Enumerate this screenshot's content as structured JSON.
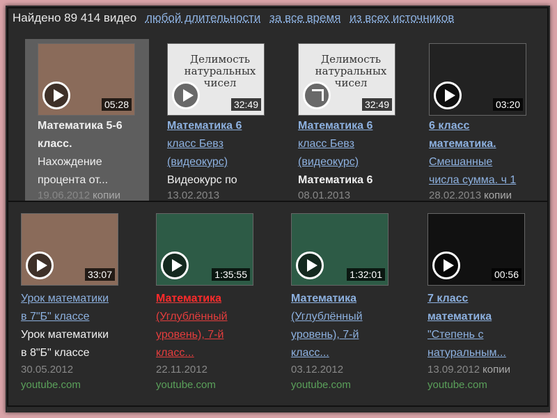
{
  "header": {
    "found": "Найдено 89 414 видео",
    "filter_duration": "любой длительности",
    "filter_time": "за все время",
    "filter_source": "из всех источников"
  },
  "row1": [
    {
      "duration": "05:28",
      "title_lines": [
        "Математика 5-6",
        "класс.",
        "Нахождение",
        "процента от..."
      ],
      "date": "19.06.2012",
      "copies": "копии"
    },
    {
      "duration": "32:49",
      "thumb_text": "Делимость натуральных чисел",
      "title_lines": [
        "Математика 6",
        "класс Бевз",
        "(видеокурс)",
        "Видеокурс по"
      ],
      "date": "13.02.2013"
    },
    {
      "duration": "32:49",
      "thumb_text": "Делимость натуральных чисел",
      "title_lines": [
        "Математика 6",
        "класс Бевз",
        "(видеокурс)",
        "Математика 6"
      ],
      "date": "08.01.2013"
    },
    {
      "duration": "03:20",
      "title_lines": [
        "6 класс",
        "математика.",
        "Смешанные",
        "числа сумма. ч 1"
      ],
      "date": "28.02.2013",
      "copies": "копии"
    }
  ],
  "row2": [
    {
      "duration": "33:07",
      "title_lines": [
        "Урок математики",
        "в 7\"Б\" классе",
        "Урок математики",
        "в 8\"Б\" классе"
      ],
      "date": "30.05.2012",
      "source": "youtube.com"
    },
    {
      "duration": "1:35:55",
      "title_lines": [
        "Математика",
        "(Углублённый",
        "уровень), 7-й",
        "класс..."
      ],
      "date": "22.11.2012",
      "source": "youtube.com"
    },
    {
      "duration": "1:32:01",
      "title_lines": [
        "Математика",
        "(Углублённый",
        "уровень), 7-й",
        "класс..."
      ],
      "date": "03.12.2012",
      "source": "youtube.com"
    },
    {
      "duration": "00:56",
      "title_lines": [
        "7 класс",
        "математика",
        "\"Степень с",
        "натуральным..."
      ],
      "date": "13.09.2012",
      "copies": "копии",
      "source": "youtube.com"
    }
  ]
}
